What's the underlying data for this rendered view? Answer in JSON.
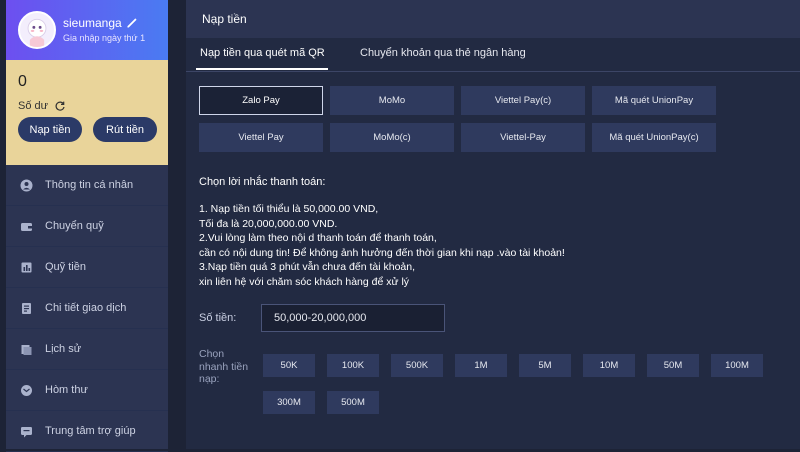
{
  "profile": {
    "username": "sieumanga",
    "joined": "Gia nhập ngày thứ 1"
  },
  "wallet": {
    "balance": "0",
    "balance_label": "Số dư",
    "deposit_label": "Nạp tiền",
    "withdraw_label": "Rút tiền"
  },
  "menu": {
    "items": [
      {
        "label": "Thông tin cá nhân",
        "icon": "user-icon"
      },
      {
        "label": "Chuyển quỹ",
        "icon": "wallet-icon"
      },
      {
        "label": "Quỹ tiền",
        "icon": "fund-icon"
      },
      {
        "label": "Chi tiết giao dịch",
        "icon": "transactions-icon"
      },
      {
        "label": "Lịch sử",
        "icon": "history-icon"
      },
      {
        "label": "Hòm thư",
        "icon": "mailbox-icon"
      },
      {
        "label": "Trung tâm trợ giúp",
        "icon": "help-icon"
      }
    ]
  },
  "main": {
    "title": "Nạp tiền",
    "tabs": [
      {
        "label": "Nạp tiền qua quét mã QR",
        "active": true
      },
      {
        "label": "Chuyển khoản qua thẻ ngân hàng",
        "active": false
      }
    ],
    "methods": [
      {
        "label": "Zalo Pay",
        "selected": true
      },
      {
        "label": "MoMo",
        "selected": false
      },
      {
        "label": "Viettel Pay(c)",
        "selected": false
      },
      {
        "label": "Mã quét UnionPay",
        "selected": false
      },
      {
        "label": "Viettel Pay",
        "selected": false
      },
      {
        "label": "MoMo(c)",
        "selected": false
      },
      {
        "label": "Viettel-Pay",
        "selected": false
      },
      {
        "label": "Mã quét UnionPay(c)",
        "selected": false
      }
    ],
    "instructions_title": "Chọn lời nhắc thanh toán:",
    "instructions": [
      "1. Nạp tiền tối thiểu là 50,000.00 VND,",
      "Tối đa là 20,000,000.00 VND.",
      "2.Vui lòng làm theo nội d thanh toán để thanh toán,",
      "cần có nội dung tin! Để không ảnh hưởng đến thời gian khi nạp .vào tài khoản!",
      "3.Nạp tiền quá 3 phút vẫn chưa đến tài khoản,",
      "xin liên hệ với chăm sóc khách hàng để xử lý"
    ],
    "amount_label": "Số tiền:",
    "amount_placeholder": "50,000-20,000,000",
    "quick_label": "Chọn nhanh tiền nạp:",
    "quick_amounts": [
      "50K",
      "100K",
      "500K",
      "1M",
      "5M",
      "10M",
      "50M",
      "100M",
      "300M",
      "500M"
    ]
  },
  "colors": {
    "accent_gradient_start": "#6d4ff0",
    "accent_gradient_end": "#4a7bf2",
    "wallet_bg": "#e9d49a",
    "button_bg": "#2b3a67",
    "panel_bg": "#222a42"
  }
}
